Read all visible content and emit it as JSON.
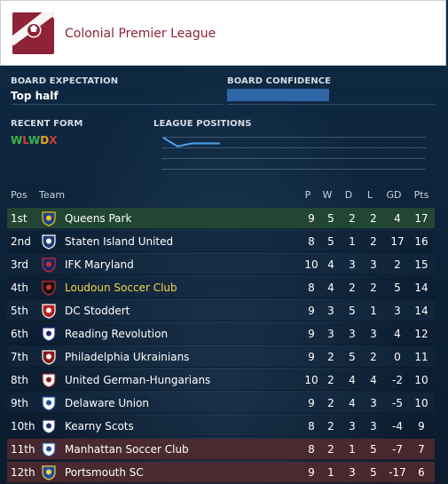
{
  "league": {
    "name": "Colonial Premier League",
    "logo_icon": "league-crest-icon",
    "brand_color": "#8e2236"
  },
  "board": {
    "expectation_label": "BOARD EXPECTATION",
    "expectation_value": "Top half",
    "confidence_label": "BOARD CONFIDENCE",
    "confidence_level": 0.49
  },
  "form": {
    "label": "RECENT FORM",
    "results": [
      {
        "r": "W",
        "color": "#3bb64a"
      },
      {
        "r": "L",
        "color": "#d23a3a"
      },
      {
        "r": "W",
        "color": "#3bb64a"
      },
      {
        "r": "D",
        "color": "#e6a21f"
      },
      {
        "r": "X",
        "color": "#d23a3a"
      }
    ]
  },
  "positions": {
    "label": "LEAGUE POSITIONS",
    "history": [
      1,
      4,
      3,
      3,
      3
    ]
  },
  "table": {
    "headers": {
      "pos": "Pos",
      "team": "Team",
      "p": "P",
      "w": "W",
      "d": "D",
      "l": "L",
      "gd": "GD",
      "pts": "Pts"
    },
    "rows": [
      {
        "pos": "1st",
        "team": "Queens Park",
        "p": "9",
        "w": "5",
        "d": "2",
        "l": "2",
        "gd": "4",
        "pts": "17",
        "highlight": "promo",
        "crest": "queens-park-crest-icon"
      },
      {
        "pos": "2nd",
        "team": "Staten Island United",
        "p": "8",
        "w": "5",
        "d": "1",
        "l": "2",
        "gd": "17",
        "pts": "16",
        "highlight": "",
        "crest": "staten-island-crest-icon"
      },
      {
        "pos": "3rd",
        "team": "IFK Maryland",
        "p": "10",
        "w": "4",
        "d": "3",
        "l": "3",
        "gd": "2",
        "pts": "15",
        "highlight": "",
        "crest": "ifk-maryland-crest-icon"
      },
      {
        "pos": "4th",
        "team": "Loudoun Soccer Club",
        "p": "8",
        "w": "4",
        "d": "2",
        "l": "2",
        "gd": "5",
        "pts": "14",
        "highlight": "user",
        "crest": "loudoun-crest-icon"
      },
      {
        "pos": "5th",
        "team": "DC Stoddert",
        "p": "9",
        "w": "3",
        "d": "5",
        "l": "1",
        "gd": "3",
        "pts": "14",
        "highlight": "",
        "crest": "dc-stoddert-crest-icon"
      },
      {
        "pos": "6th",
        "team": "Reading Revolution",
        "p": "9",
        "w": "3",
        "d": "3",
        "l": "3",
        "gd": "4",
        "pts": "12",
        "highlight": "",
        "crest": "reading-revolution-crest-icon"
      },
      {
        "pos": "7th",
        "team": "Philadelphia Ukrainians",
        "p": "9",
        "w": "2",
        "d": "5",
        "l": "2",
        "gd": "0",
        "pts": "11",
        "highlight": "",
        "crest": "philadelphia-ukrainians-crest-icon"
      },
      {
        "pos": "8th",
        "team": "United German-Hungarians",
        "p": "10",
        "w": "2",
        "d": "4",
        "l": "4",
        "gd": "-2",
        "pts": "10",
        "highlight": "",
        "crest": "united-german-hungarians-crest-icon"
      },
      {
        "pos": "9th",
        "team": "Delaware Union",
        "p": "9",
        "w": "2",
        "d": "4",
        "l": "3",
        "gd": "-5",
        "pts": "10",
        "highlight": "",
        "crest": "delaware-union-crest-icon"
      },
      {
        "pos": "10th",
        "team": "Kearny Scots",
        "p": "8",
        "w": "2",
        "d": "3",
        "l": "3",
        "gd": "-4",
        "pts": "9",
        "highlight": "",
        "crest": "kearny-scots-crest-icon"
      },
      {
        "pos": "11th",
        "team": "Manhattan Soccer Club",
        "p": "8",
        "w": "2",
        "d": "1",
        "l": "5",
        "gd": "-7",
        "pts": "7",
        "highlight": "releg",
        "crest": "manhattan-crest-icon"
      },
      {
        "pos": "12th",
        "team": "Portsmouth SC",
        "p": "9",
        "w": "1",
        "d": "3",
        "l": "5",
        "gd": "-17",
        "pts": "6",
        "highlight": "releg",
        "crest": "portsmouth-crest-icon"
      }
    ]
  }
}
